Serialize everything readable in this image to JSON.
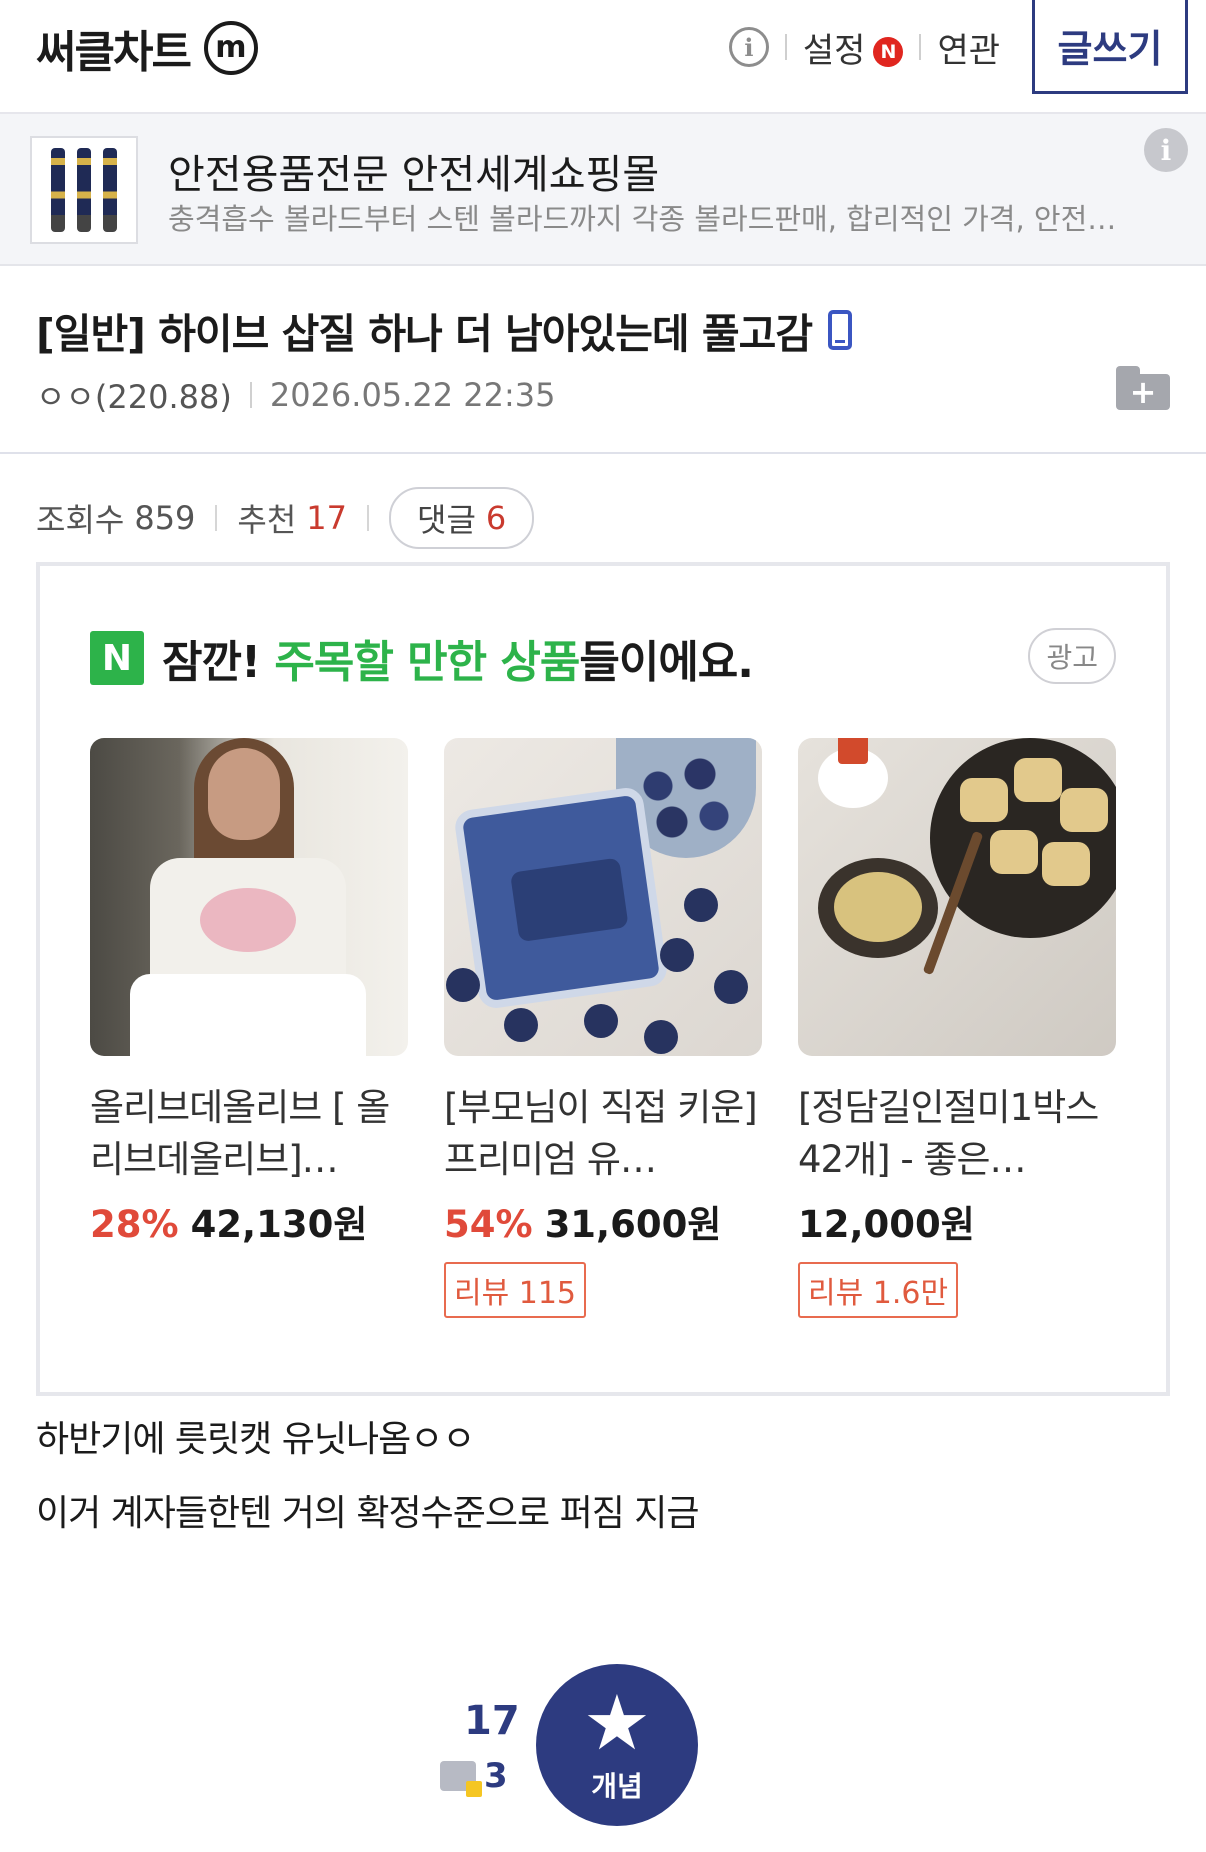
{
  "header": {
    "title": "써클차트",
    "mark": "m",
    "info_icon": "i",
    "settings": "설정",
    "settings_badge": "N",
    "related": "연관",
    "write": "글쓰기"
  },
  "ad_banner": {
    "title": "안전용품전문 안전세계쇼핑몰",
    "description": "충격흡수 볼라드부터 스텐 볼라드까지 각종 볼라드판매, 합리적인 가격, 안전…",
    "info_icon": "i"
  },
  "post": {
    "title": "[일반] 하이브 삽질 하나 더 남아있는데 풀고감",
    "author": "ㅇㅇ(220.88)",
    "date": "2026.05.22 22:35",
    "folder_icon": "+",
    "views_label": "조회수",
    "views": "859",
    "recommend_label": "추천",
    "recommend": "17",
    "comments_label": "댓글",
    "comments": "6",
    "body": [
      "하반기에 릇릿캣 유닛나옴ㅇㅇ",
      "이거 계자들한텐 거의 확정수준으로 퍼짐 지금"
    ]
  },
  "promo": {
    "badge": "N",
    "lead": "잠깐! ",
    "highlight": "주목할 만한 상품",
    "tail": "들이에요.",
    "ad_label": "광고",
    "products": [
      {
        "name": "올리브데올리브 [ 올리브데올리브]…",
        "discount": "28%",
        "price": "42,130원",
        "review": ""
      },
      {
        "name": "[부모님이 직접 키운] 프리미엄 유…",
        "discount": "54%",
        "price": "31,600원",
        "review": "리뷰 115"
      },
      {
        "name": "[정담길인절미1박스42개] - 좋은…",
        "discount": "",
        "price": "12,000원",
        "review": "리뷰 1.6만"
      }
    ]
  },
  "recommend": {
    "count": "17",
    "fixed_count": "3",
    "button_label": "개념"
  },
  "colors": {
    "brand_navy": "#2d3b80",
    "naver_green": "#2db34a",
    "discount_red": "#e04a3a",
    "badge_red": "#e0261f"
  }
}
